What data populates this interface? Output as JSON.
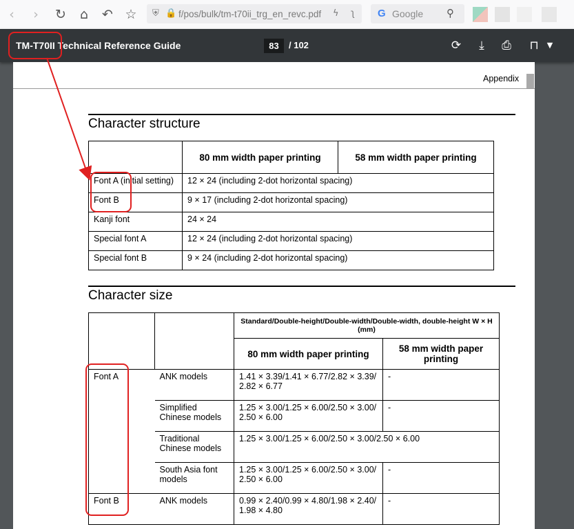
{
  "browser": {
    "back_icon": "chevron-left-icon",
    "forward_icon": "chevron-right-icon",
    "url": "f/pos/bulk/tm-t70ii_trg_en_revc.pdf",
    "search_engine": "Google",
    "search_placeholder": "Google"
  },
  "viewer": {
    "title": "TM-T70II Technical Reference Guide",
    "current_page": "83",
    "total_pages": "/ 102"
  },
  "page": {
    "header_label": "Appendix",
    "char_structure": {
      "title": "Character structure",
      "col_80": "80 mm width paper printing",
      "col_58": "58 mm width paper printing",
      "rows": [
        {
          "font": "Font A (initial setting)",
          "value": "12 × 24 (including 2-dot horizontal spacing)"
        },
        {
          "font": "Font B",
          "value": "9 × 17 (including 2-dot horizontal spacing)"
        },
        {
          "font": "Kanji font",
          "value": "24 × 24"
        },
        {
          "font": "Special font A",
          "value": "12 × 24 (including 2-dot horizontal spacing)"
        },
        {
          "font": "Special font B",
          "value": "9 × 24 (including 2-dot horizontal spacing)"
        }
      ]
    },
    "char_size": {
      "title": "Character size",
      "header_std": "Standard/Double-height/Double-width/Double-width, double-height W × H (mm)",
      "col_80": "80 mm width paper printing",
      "col_58": "58 mm width paper printing",
      "font_a": "Font A",
      "font_b": "Font B",
      "rows": [
        {
          "model": "ANK models",
          "v80": "1.41 × 3.39/1.41 × 6.77/2.82 × 3.39/ 2.82 × 6.77",
          "v58": "-"
        },
        {
          "model": "Simplified Chinese models",
          "v80": "1.25 × 3.00/1.25 × 6.00/2.50 × 3.00/ 2.50 × 6.00",
          "v58": "-"
        },
        {
          "model": "Traditional Chinese models",
          "v80": "1.25 × 3.00/1.25 × 6.00/2.50 × 3.00/2.50 × 6.00"
        },
        {
          "model": "South Asia font models",
          "v80": "1.25 × 3.00/1.25 × 6.00/2.50 × 3.00/ 2.50 × 6.00",
          "v58": "-"
        },
        {
          "model": "ANK models",
          "v80": "0.99 × 2.40/0.99 × 4.80/1.98 × 2.40/ 1.98 × 4.80",
          "v58": "-"
        }
      ]
    }
  }
}
